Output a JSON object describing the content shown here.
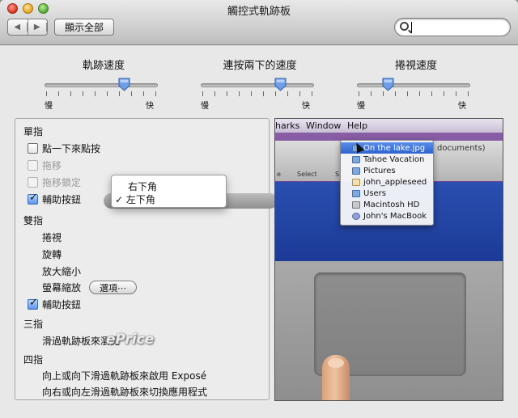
{
  "window": {
    "title": "觸控式軌跡板"
  },
  "toolbar": {
    "back_glyph": "◀",
    "forward_glyph": "▶",
    "show_all_label": "顯示全部",
    "search": {
      "value": "",
      "placeholder": ""
    }
  },
  "sliders": [
    {
      "label": "軌跡速度",
      "min_label": "慢",
      "max_label": "快",
      "value": 0.73
    },
    {
      "label": "連按兩下的速度",
      "min_label": "慢",
      "max_label": "快",
      "value": 0.73
    },
    {
      "label": "捲視速度",
      "min_label": "慢",
      "max_label": "快",
      "value": 0.25
    }
  ],
  "one_finger": {
    "heading": "單指",
    "tap_to_click": {
      "label": "點一下來點按",
      "checked": false
    },
    "dragging": {
      "label": "拖移",
      "checked": false,
      "enabled": false
    },
    "drag_lock": {
      "label": "拖移鎖定",
      "checked": false,
      "enabled": false
    },
    "secondary_click": {
      "label": "輔助按鈕",
      "checked": true
    }
  },
  "corner_popup": {
    "options": [
      "右下角",
      "左下角"
    ],
    "selected_index": 1,
    "check_glyph": "✓"
  },
  "two_fingers": {
    "heading": "雙指",
    "scroll": "捲視",
    "rotate": "旋轉",
    "zoom": "放大縮小",
    "screen_zoom": "螢幕縮放",
    "options_button": "選項⋯",
    "secondary_click": {
      "label": "輔助按鈕",
      "checked": true
    }
  },
  "three_fingers": {
    "heading": "三指",
    "swipe": "滑過軌跡板來瀏覽"
  },
  "four_fingers": {
    "heading": "四指",
    "expose": "向上或向下滑過軌跡板來啟用 Exposé",
    "switch_apps": "向右或向左滑過軌跡板來切換應用程式"
  },
  "demo": {
    "menubar": [
      "harks",
      "Window",
      "Help"
    ],
    "finder_caption": "documents)",
    "finder_captions": [
      "e",
      "Select",
      "S"
    ],
    "menu_items": [
      {
        "label": "On the lake.jpg",
        "icon": "image-icon",
        "highlighted": true
      },
      {
        "label": "Tahoe Vacation",
        "icon": "folder-icon"
      },
      {
        "label": "Pictures",
        "icon": "folder-icon"
      },
      {
        "label": "john_appleseed",
        "icon": "home-icon"
      },
      {
        "label": "Users",
        "icon": "folder-icon"
      },
      {
        "label": "Macintosh HD",
        "icon": "disk-icon"
      },
      {
        "label": "John's MacBook",
        "icon": "computer-icon"
      }
    ]
  },
  "watermark": "ePrice"
}
